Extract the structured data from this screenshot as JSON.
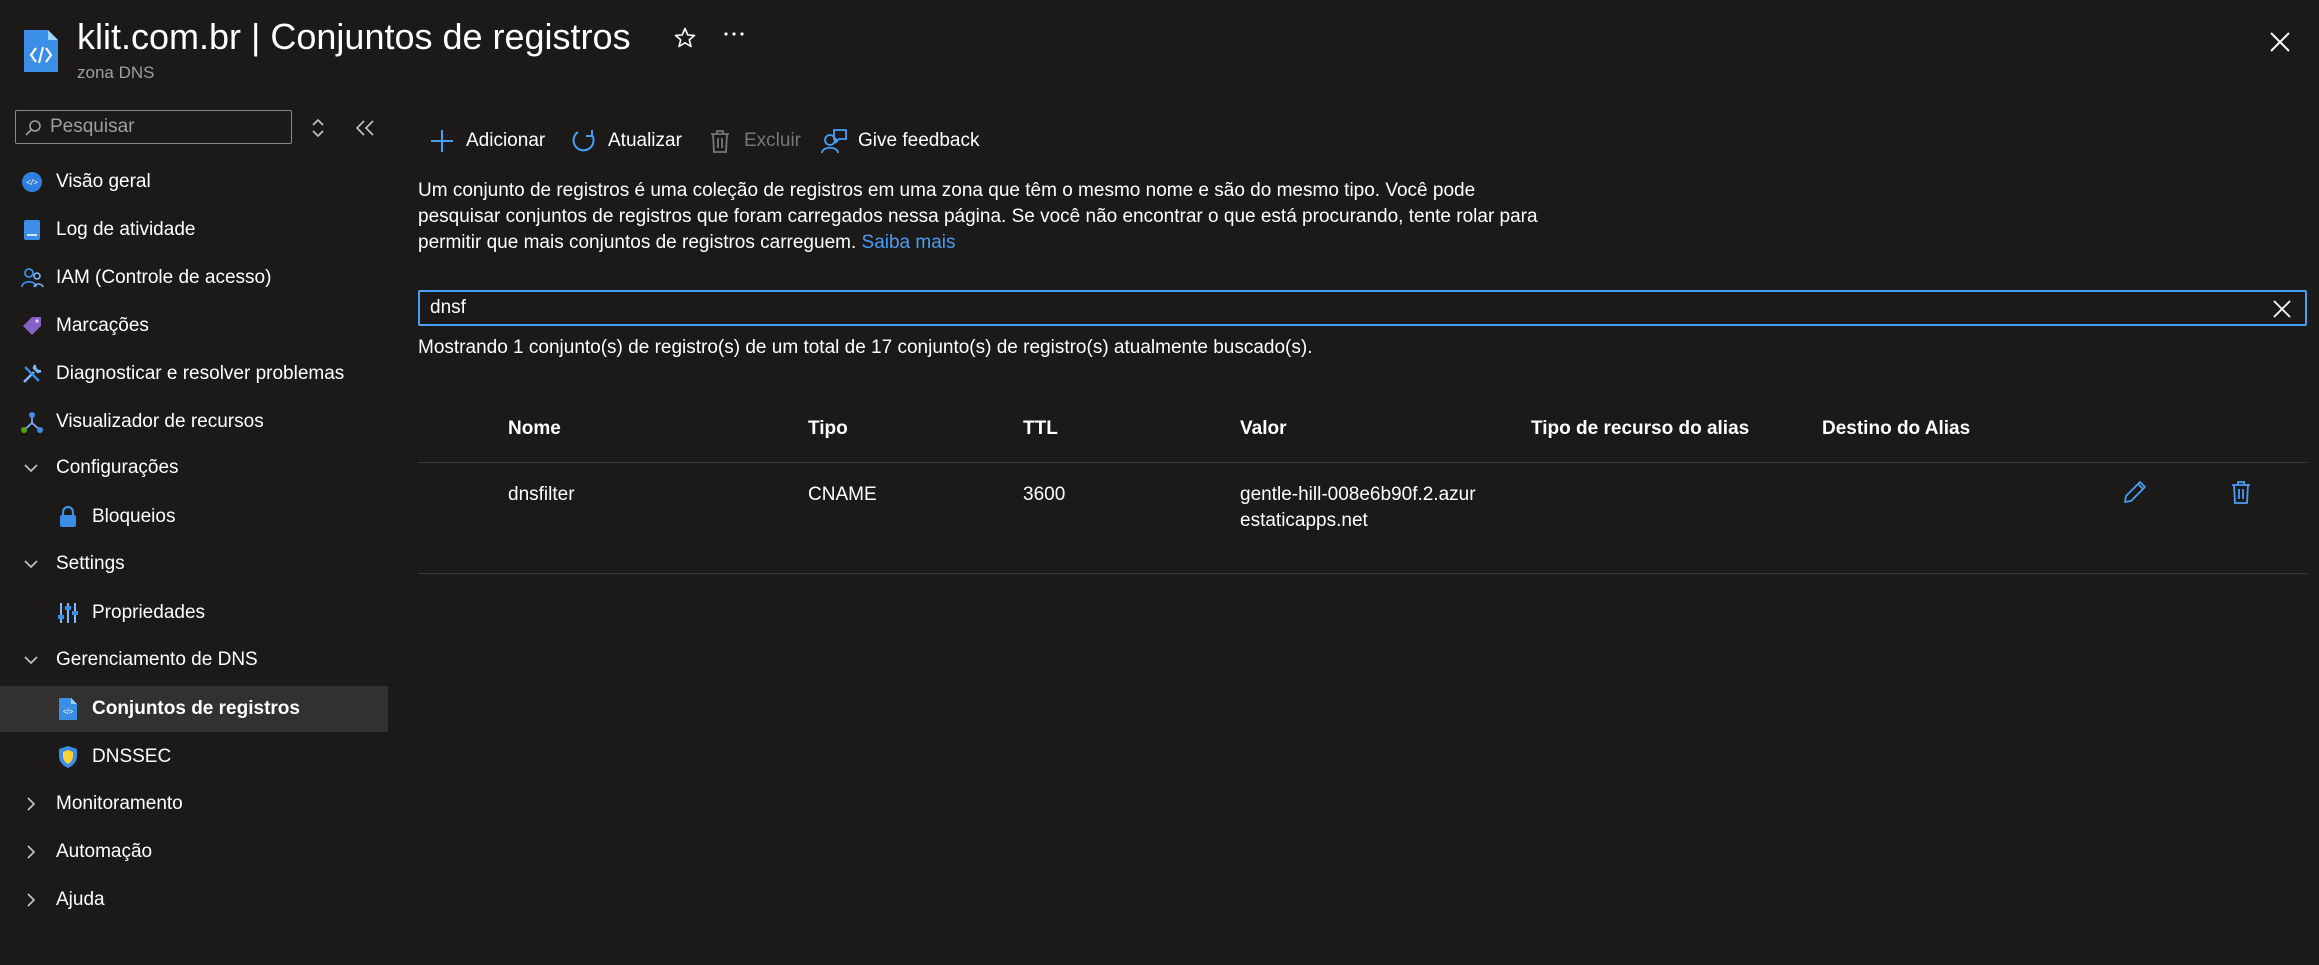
{
  "header": {
    "title": "klit.com.br | Conjuntos de registros",
    "subtitle": "zona DNS"
  },
  "sidebar": {
    "search_placeholder": "Pesquisar",
    "items": [
      {
        "label": "Visão geral",
        "icon": "dns-overview-icon"
      },
      {
        "label": "Log de atividade",
        "icon": "activity-log-icon"
      },
      {
        "label": "IAM (Controle de acesso)",
        "icon": "iam-people-icon"
      },
      {
        "label": "Marcações",
        "icon": "tag-icon"
      },
      {
        "label": "Diagnosticar e resolver problemas",
        "icon": "wrench-icon"
      },
      {
        "label": "Visualizador de recursos",
        "icon": "resource-visualizer-icon"
      },
      {
        "label": "Configurações",
        "icon": "chevron-down-icon",
        "expanded": true
      },
      {
        "label": "Bloqueios",
        "icon": "lock-icon"
      },
      {
        "label": "Settings",
        "icon": "chevron-down-icon",
        "expanded": true
      },
      {
        "label": "Propriedades",
        "icon": "properties-icon"
      },
      {
        "label": "Gerenciamento de DNS",
        "icon": "chevron-down-icon",
        "expanded": true
      },
      {
        "label": "Conjuntos de registros",
        "icon": "record-sets-icon",
        "selected": true
      },
      {
        "label": "DNSSEC",
        "icon": "shield-icon"
      },
      {
        "label": "Monitoramento",
        "icon": "chevron-right-icon",
        "expanded": false
      },
      {
        "label": "Automação",
        "icon": "chevron-right-icon",
        "expanded": false
      },
      {
        "label": "Ajuda",
        "icon": "chevron-right-icon",
        "expanded": false
      }
    ]
  },
  "toolbar": {
    "add_label": "Adicionar",
    "refresh_label": "Atualizar",
    "delete_label": "Excluir",
    "feedback_label": "Give feedback"
  },
  "description": {
    "text": "Um conjunto de registros é uma coleção de registros em uma zona que têm o mesmo nome e são do mesmo tipo. Você pode pesquisar conjuntos de registros que foram carregados nessa página. Se você não encontrar o que está procurando, tente rolar para permitir que mais conjuntos de registros carreguem.",
    "link": "Saiba mais"
  },
  "filter": {
    "value": "dnsf"
  },
  "result_count": "Mostrando 1 conjunto(s) de registro(s) de um total de 17 conjunto(s) de registro(s) atualmente buscado(s).",
  "table": {
    "columns": [
      "Nome",
      "Tipo",
      "TTL",
      "Valor",
      "Tipo de recurso do alias",
      "Destino do Alias"
    ],
    "rows": [
      {
        "name": "dnsfilter",
        "type": "CNAME",
        "ttl": "3600",
        "value": "gentle-hill-008e6b90f.2.azurestaticapps.net",
        "alias_type": "",
        "alias_target": ""
      }
    ]
  },
  "colors": {
    "background": "#1b1a19",
    "accent": "#479ef5",
    "selected_bg": "#323130",
    "muted_text": "#a19f9d"
  }
}
